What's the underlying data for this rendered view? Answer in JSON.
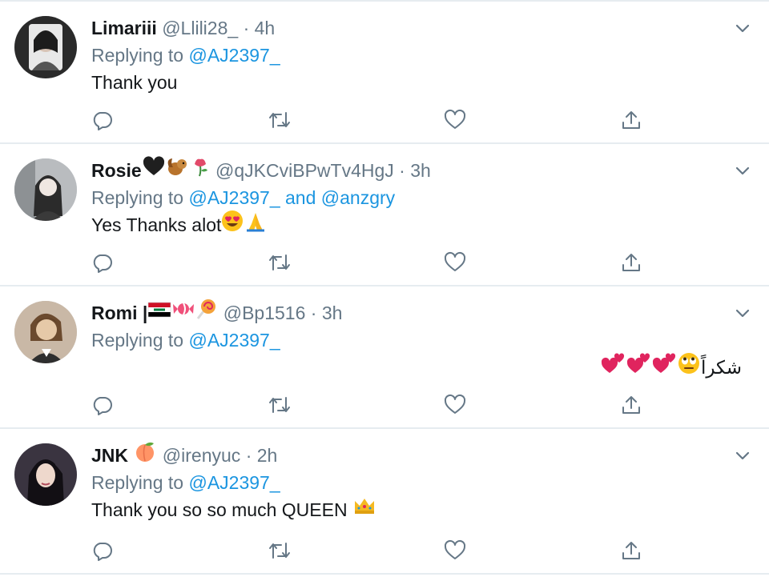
{
  "replies": [
    {
      "name": "Limariii",
      "handle": "@Llili28_",
      "time": "4h",
      "replying_label": "Replying to",
      "mentions": [
        "@AJ2397_"
      ],
      "text": "Thank you"
    },
    {
      "name": "Rosie",
      "handle": "@qJKCviBPwTv4HgJ",
      "time": "3h",
      "replying_label": "Replying to",
      "mentions": [
        "@AJ2397_",
        "@anzgry"
      ],
      "mention_joiner": "and",
      "text": "Yes Thanks alot"
    },
    {
      "name": "Romi |",
      "handle": "@Bp1516",
      "time": "3h",
      "replying_label": "Replying to",
      "mentions": [
        "@AJ2397_"
      ],
      "text": "شكراً"
    },
    {
      "name": "JNK",
      "handle": "@irenyuc",
      "time": "2h",
      "replying_label": "Replying to",
      "mentions": [
        "@AJ2397_"
      ],
      "text": "Thank you so so much QUEEN"
    }
  ],
  "separator": "·",
  "colors": {
    "link": "#1b95e0",
    "secondary": "#657786",
    "primary": "#14171a",
    "divider": "#e6ecf0"
  },
  "icons": [
    "reply-icon",
    "retweet-icon",
    "like-icon",
    "share-icon",
    "chevron-down-icon"
  ]
}
